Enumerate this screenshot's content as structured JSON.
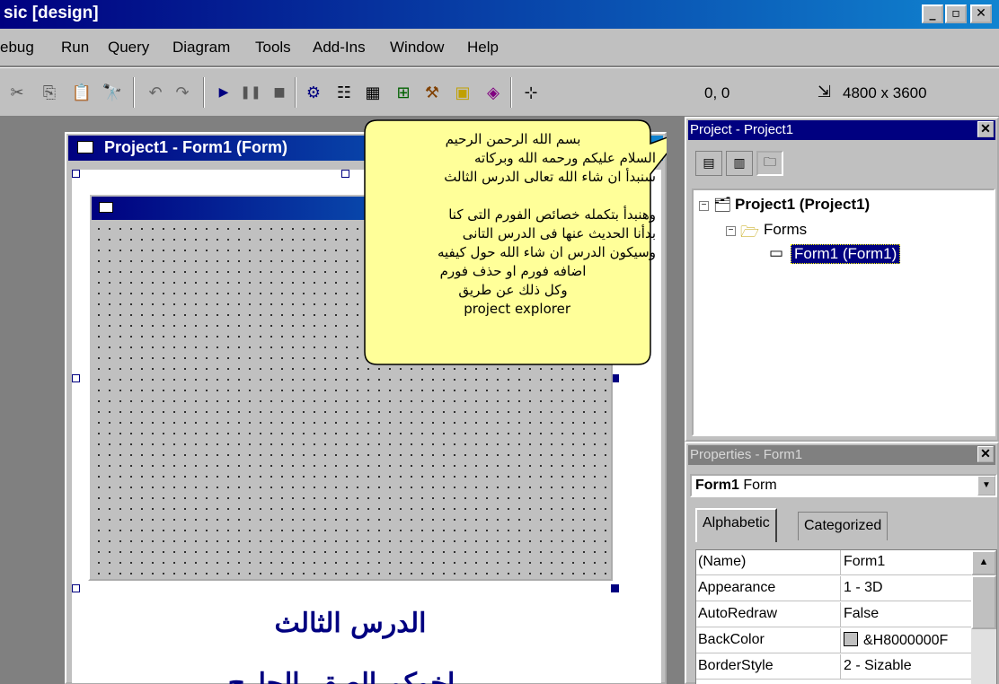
{
  "window": {
    "title": "sic [design]",
    "min_glyph": "_",
    "restore_glyph": "▫",
    "close_glyph": "✕"
  },
  "menu": {
    "items": [
      "ebug",
      "Run",
      "Query",
      "Diagram",
      "Tools",
      "Add-Ins",
      "Window",
      "Help"
    ]
  },
  "toolbar": {
    "coords": "0, 0",
    "size": "4800 x 3600",
    "size_icon": "⇲"
  },
  "designer": {
    "title": "Project1 - Form1 (Form)",
    "lesson_title": "الدرس الثالث",
    "author": "...........اخوكم الصقر الجارح..........."
  },
  "balloon": {
    "lines": [
      "بسم الله الرحمن الرحيم",
      "السلام عليكم ورحمه الله وبركاته",
      "سنبدأ ان شاء الله تعالى الدرس الثالث",
      "",
      "وهنبدأ بتكمله خصائص الفورم التى كنا",
      "بدأنا الحديث عنها فى الدرس التانى",
      "وسيكون الدرس ان شاء الله حول كيفيه",
      "اضافه فورم او حذف فورم",
      "وكل ذلك عن طريق",
      "project explorer"
    ]
  },
  "project": {
    "title": "Project - Project1",
    "close": "✕",
    "tree": {
      "root": "Project1 (Project1)",
      "folder": "Forms",
      "item": "Form1 (Form1)"
    }
  },
  "properties": {
    "title": "Properties - Form1",
    "close": "✕",
    "object_name": "Form1",
    "object_type": "Form",
    "tabs": [
      "Alphabetic",
      "Categorized"
    ],
    "rows": [
      {
        "name": "(Name)",
        "value": "Form1"
      },
      {
        "name": "Appearance",
        "value": "1 - 3D"
      },
      {
        "name": "AutoRedraw",
        "value": "False"
      },
      {
        "name": "BackColor",
        "value": "&H8000000F"
      },
      {
        "name": "BorderStyle",
        "value": "2 - Sizable"
      }
    ]
  },
  "colors": {
    "titlebar": "#000080",
    "face": "#c0c0c0",
    "balloon": "#ffff99",
    "arabic_text": "#000080"
  }
}
